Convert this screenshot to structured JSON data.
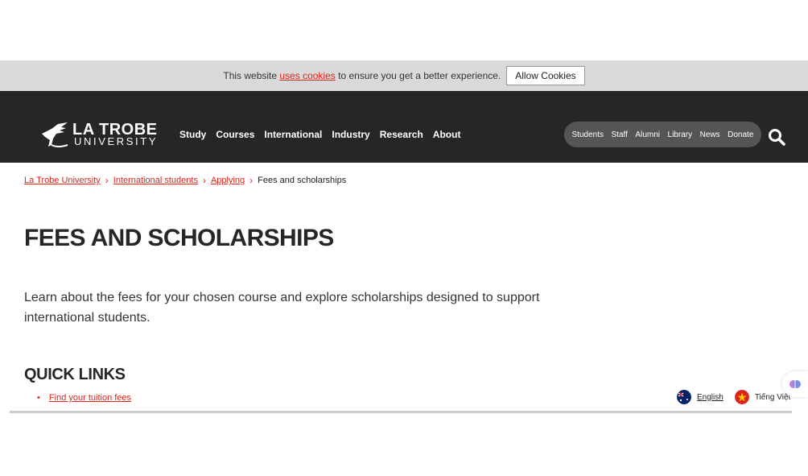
{
  "cookie": {
    "text_before": "This website",
    "link": "uses cookies",
    "text_after": "to ensure you get a better experience.",
    "button": "Allow Cookies"
  },
  "header": {
    "logo_line1": "LA TROBE",
    "logo_line2": "UNIVERSITY",
    "nav": [
      "Study",
      "Courses",
      "International",
      "Industry",
      "Research",
      "About"
    ],
    "utility": [
      "Students",
      "Staff",
      "Alumni",
      "Library",
      "News",
      "Donate"
    ]
  },
  "breadcrumb": [
    "La Trobe University",
    "International students",
    "Applying",
    "Fees and scholarships"
  ],
  "page": {
    "title": "FEES AND SCHOLARSHIPS",
    "intro": "Learn about the fees for your chosen course and explore scholarships designed to support international students.",
    "quick_links_heading": "QUICK LINKS",
    "quick_links": [
      "Find your tuition fees"
    ]
  },
  "language": {
    "english": "English",
    "vietnamese": "Tiếng Việt"
  },
  "colors": {
    "accent": "#e2231a",
    "header_bg": "#262626"
  }
}
